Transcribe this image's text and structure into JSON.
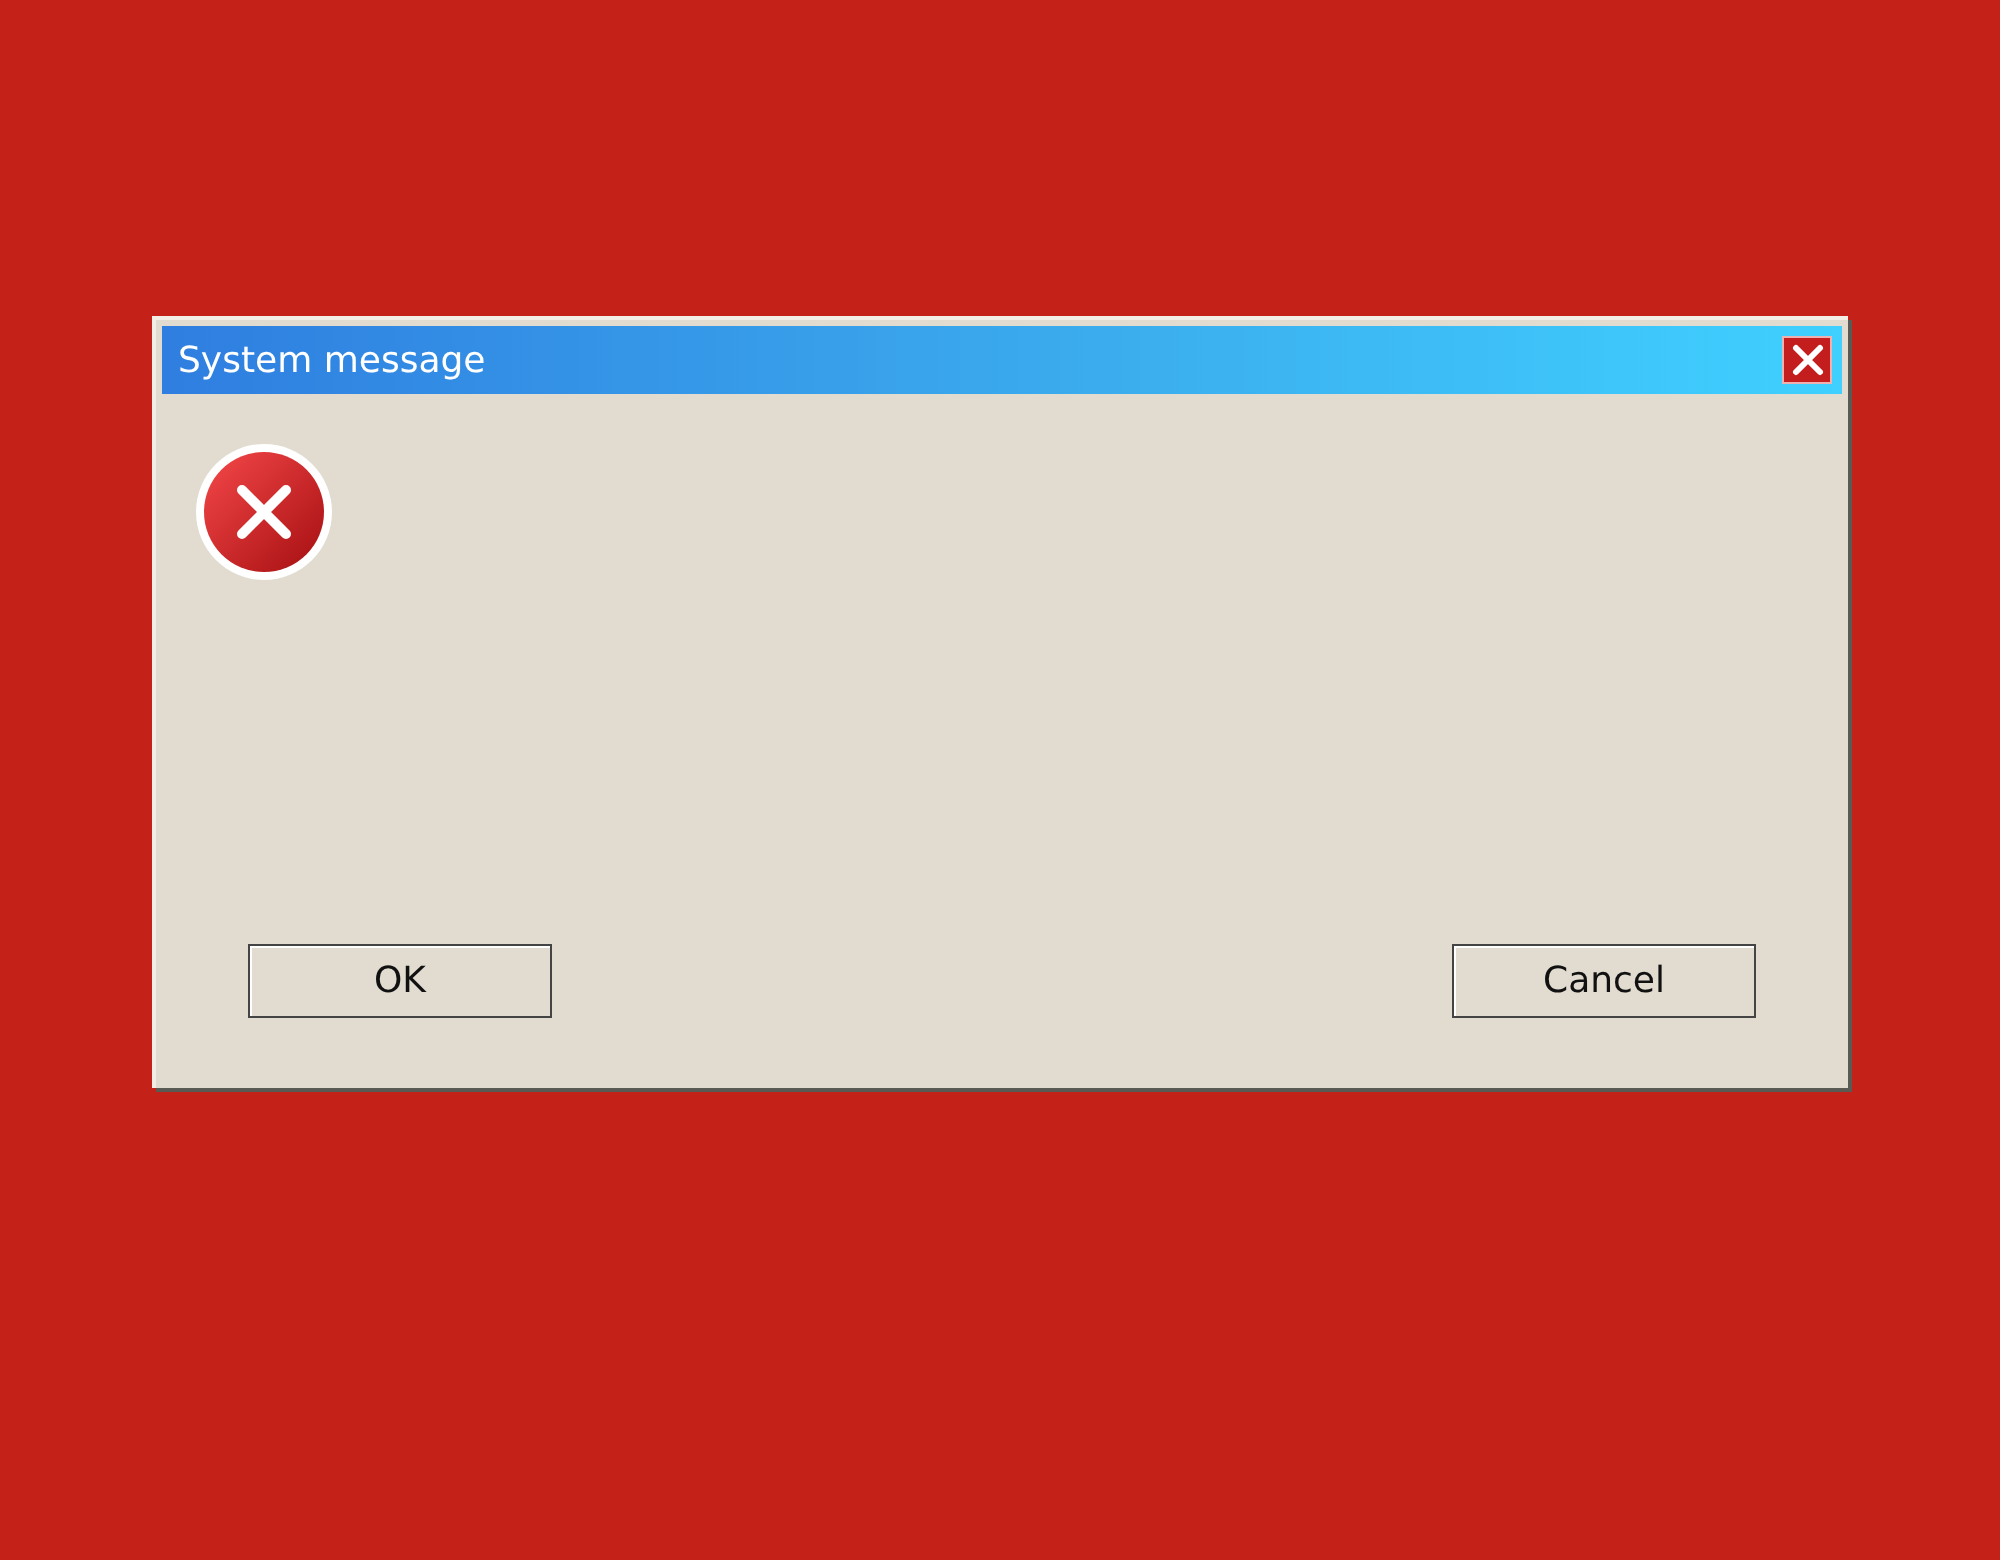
{
  "window": {
    "title": "System message"
  },
  "buttons": [
    "OK",
    "Cancel"
  ]
}
